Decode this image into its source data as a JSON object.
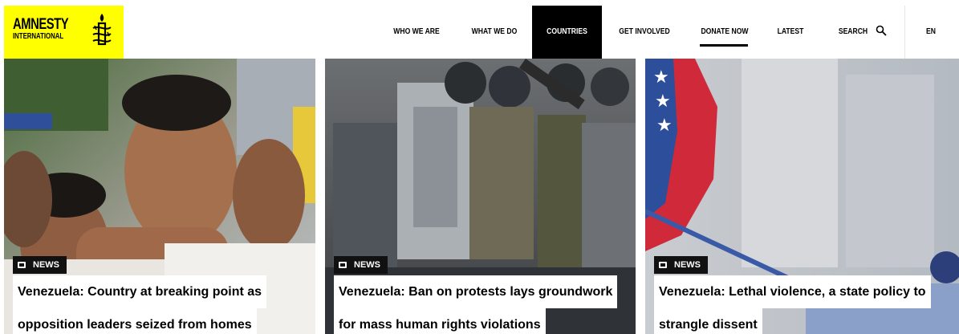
{
  "logo": {
    "line1": "AMNESTY",
    "line2": "INTERNATIONAL",
    "brand_color": "#ffff00"
  },
  "nav": {
    "items": [
      {
        "label": "WHO WE ARE"
      },
      {
        "label": "WHAT WE DO"
      },
      {
        "label": "COUNTRIES",
        "active": true
      },
      {
        "label": "GET INVOLVED"
      },
      {
        "label": "DONATE NOW",
        "underlined": true
      },
      {
        "label": "LATEST"
      },
      {
        "label": "SEARCH",
        "icon": "search-icon"
      },
      {
        "label": "EN"
      }
    ]
  },
  "cards": [
    {
      "badge": "NEWS",
      "badge_icon": "news-icon",
      "title_lines": [
        "Venezuela: Country at breaking point as",
        "opposition leaders seized from homes"
      ]
    },
    {
      "badge": "NEWS",
      "badge_icon": "news-icon",
      "title_lines": [
        "Venezuela: Ban on protests lays groundwork",
        "for mass human rights violations"
      ]
    },
    {
      "badge": "NEWS",
      "badge_icon": "news-icon",
      "title_lines": [
        "Venezuela: Lethal violence, a state policy to",
        "strangle dissent"
      ]
    }
  ]
}
